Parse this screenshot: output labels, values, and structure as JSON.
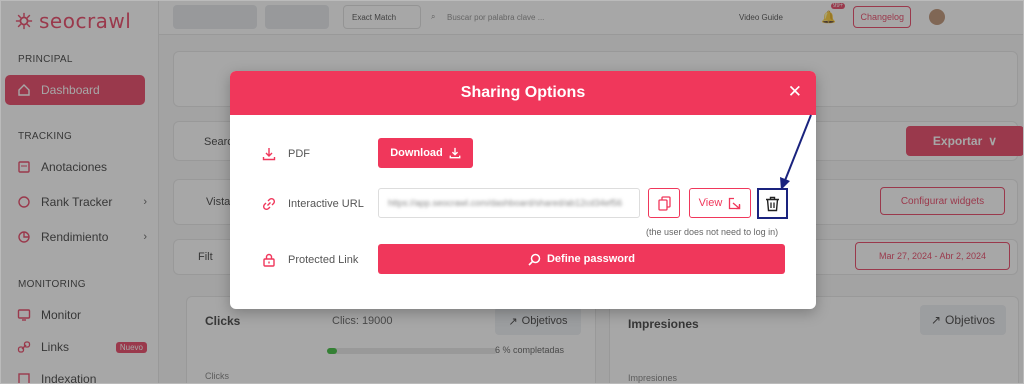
{
  "app": {
    "brand": "seocrawl"
  },
  "sidebar": {
    "sections": {
      "principal": "PRINCIPAL",
      "tracking": "TRACKING",
      "monitoring": "MONITORING"
    },
    "items": [
      {
        "label": "Dashboard",
        "icon": "home-icon"
      },
      {
        "label": "Anotaciones",
        "icon": "note-icon"
      },
      {
        "label": "Rank Tracker",
        "icon": "target-icon"
      },
      {
        "label": "Rendimiento",
        "icon": "chart-icon"
      },
      {
        "label": "Monitor",
        "icon": "monitor-icon"
      },
      {
        "label": "Links",
        "icon": "link-icon",
        "badge": "Nuevo"
      },
      {
        "label": "Indexation",
        "icon": "index-icon"
      }
    ]
  },
  "topbar": {
    "match_mode": "Exact Match",
    "search_placeholder": "Buscar por palabra clave ...",
    "video_guide": "Video Guide",
    "notifications_count": "99+",
    "changelog": "Changelog"
  },
  "background": {
    "export_label": "Exportar",
    "configure_widgets": "Configurar widgets",
    "date_range": "Mar 27, 2024 - Abr 2, 2024",
    "clicks_title": "Clicks",
    "clicks_value": "Clics: 19000",
    "objetivos_label": "Objetivos",
    "progress_text": "6 % completadas",
    "progress_fraction": 0.06,
    "impressions_title": "Impresiones",
    "clicks_axis": "Clicks",
    "impressions_axis": "Impresiones",
    "search_partial": "Searc",
    "vista_partial": "Vista",
    "filter_partial": "Filt"
  },
  "modal": {
    "title": "Sharing Options",
    "pdf_label": "PDF",
    "download_label": "Download",
    "interactive_url_label": "Interactive URL",
    "url_value": "https://app.seocrawl.com/dashboard/shared/ab12cd34ef56",
    "view_label": "View",
    "hint": "(the user does not need to log in)",
    "protected_link_label": "Protected Link",
    "define_password_label": "Define password"
  },
  "colors": {
    "accent": "#f0375b",
    "annotation": "#1a237e"
  }
}
